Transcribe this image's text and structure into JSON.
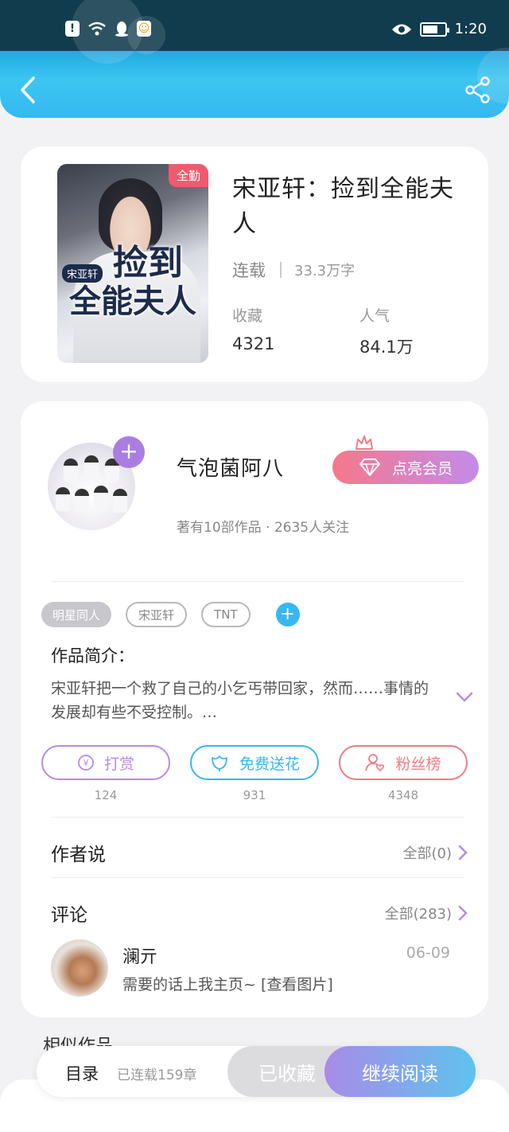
{
  "status_bar": {
    "time": "1:20"
  },
  "book": {
    "title": "宋亚轩：捡到全能夫人",
    "status": "连载",
    "word_count": "33.3万字",
    "favorites_label": "收藏",
    "favorites": "4321",
    "popularity_label": "人气",
    "popularity": "84.1万",
    "cover": {
      "badge": "全勤",
      "tag": "宋亚轩",
      "line1": "捡到",
      "line2": "全能夫人"
    }
  },
  "author": {
    "name": "气泡菌阿八",
    "stats": "著有10部作品 · 2635人关注",
    "vip_label": "点亮会员",
    "follow_symbol": "+"
  },
  "tags": [
    "明星同人",
    "宋亚轩",
    "TNT"
  ],
  "tag_add_symbol": "+",
  "intro": {
    "heading": "作品简介：",
    "text": "宋亚轩把一个救了自己的小乞丐带回家，然而……事情的发展却有些不受控制。…"
  },
  "actions": [
    {
      "label": "打赏",
      "count": "124",
      "color": "#b48ce6"
    },
    {
      "label": "免费送花",
      "count": "931",
      "color": "#35b8f0"
    },
    {
      "label": "粉丝榜",
      "count": "4348",
      "color": "#f07b84"
    }
  ],
  "author_says": {
    "title": "作者说",
    "more": "全部(0)"
  },
  "comments": {
    "title": "评论",
    "more": "全部(283)",
    "latest": {
      "user": "澜亓",
      "date": "06-09",
      "text": "需要的话上我主页~ [查看图片]"
    }
  },
  "similar": {
    "title": "相似作品"
  },
  "bottom_bar": {
    "toc": "目录",
    "chapters": "已连载159章",
    "collected": "已收藏",
    "continue": "继续阅读"
  },
  "colors": {
    "accent": "#35b8f0",
    "purple": "#a97ee0",
    "vip_start": "#f5788a",
    "vip_end": "#c38bea"
  },
  "icons": [
    "back-icon",
    "share-icon",
    "diamond-icon",
    "crown-icon",
    "coin-icon",
    "flower-icon",
    "user-heart-icon",
    "chevron-down-icon",
    "chevron-right-icon"
  ]
}
